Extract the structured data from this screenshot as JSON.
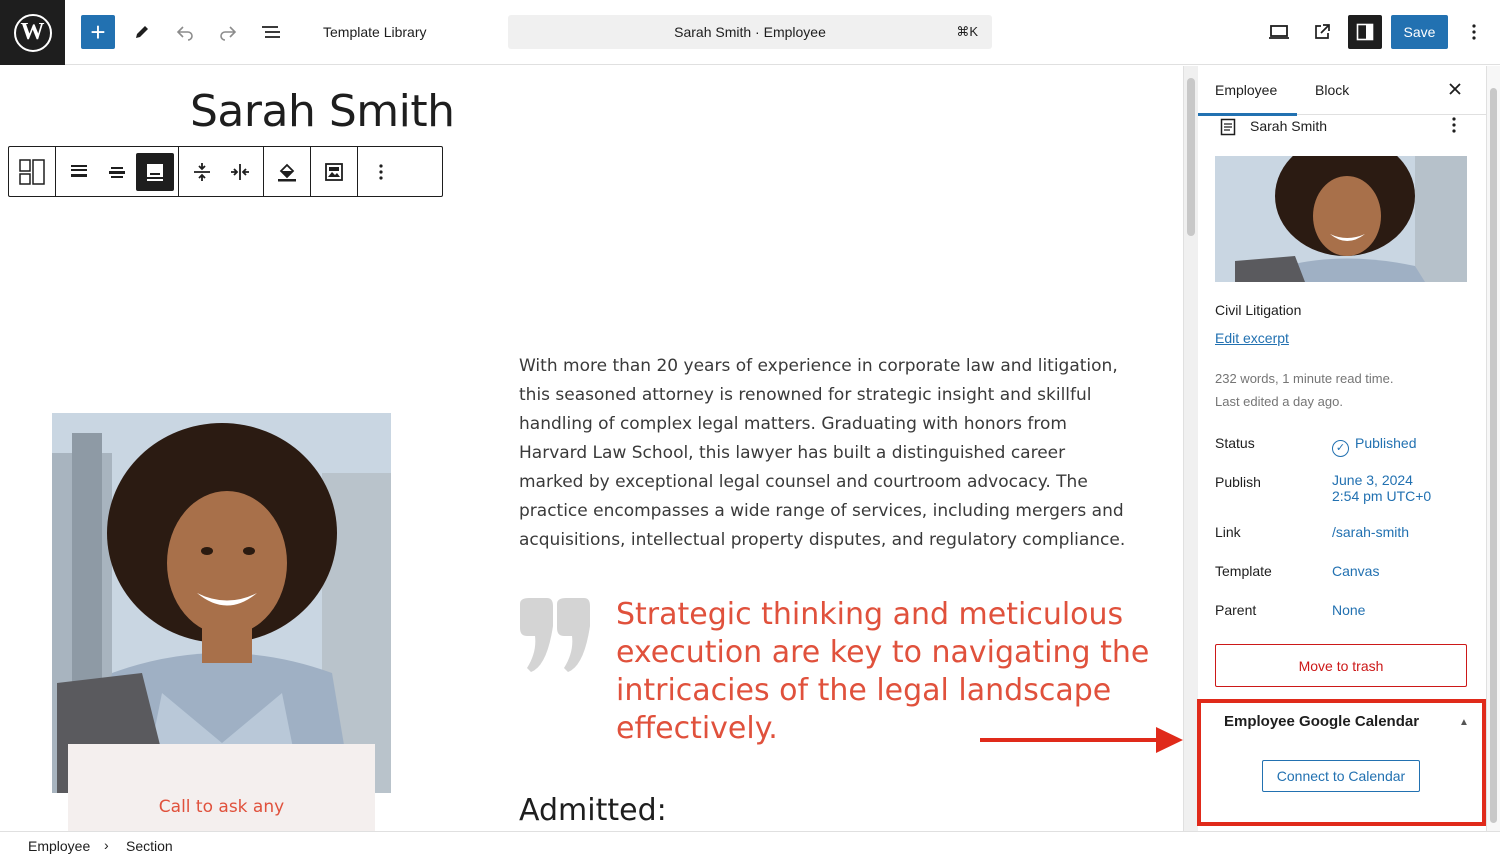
{
  "topbar": {
    "logo": "W",
    "add_icon": "+",
    "template_label": "Template Library",
    "command_text": "Sarah Smith · Employee",
    "command_shortcut": "⌘K",
    "save_label": "Save"
  },
  "canvas": {
    "page_title": "Sarah Smith",
    "bio": "With more than 20 years of experience in corporate law and litigation, this seasoned attorney is renowned for strategic insight and skillful handling of complex legal matters. Graduating with honors from Harvard Law School, this lawyer has built a distinguished career marked by exceptional legal counsel and courtroom advocacy. The practice encompasses a wide range of services, including mergers and acquisitions, intellectual property disputes, and regulatory compliance.",
    "quote": "Strategic thinking and meticulous execution are key to navigating the intricacies of the legal landscape effectively.",
    "cta": "Call to ask any",
    "admitted_heading": "Admitted:"
  },
  "sidebar": {
    "tabs": [
      "Employee",
      "Block"
    ],
    "post_title": "Sarah Smith",
    "category": "Civil Litigation",
    "edit_excerpt": "Edit excerpt",
    "meta_words": "232 words, 1 minute read time.",
    "meta_edited": "Last edited a day ago.",
    "rows": {
      "status": {
        "label": "Status",
        "value": "Published"
      },
      "publish": {
        "label": "Publish",
        "value_line1": "June 3, 2024",
        "value_line2": "2:54 pm UTC+0"
      },
      "link": {
        "label": "Link",
        "value": "/sarah-smith"
      },
      "template": {
        "label": "Template",
        "value": "Canvas"
      },
      "parent": {
        "label": "Parent",
        "value": "None"
      }
    },
    "trash_label": "Move to trash",
    "gcal": {
      "title": "Employee Google Calendar",
      "button": "Connect to Calendar"
    }
  },
  "breadcrumb": [
    "Employee",
    "Section"
  ],
  "colors": {
    "accent": "#2271b1",
    "quote": "#e0513c",
    "highlight_box": "#e02a1a",
    "danger": "#cc1818"
  }
}
